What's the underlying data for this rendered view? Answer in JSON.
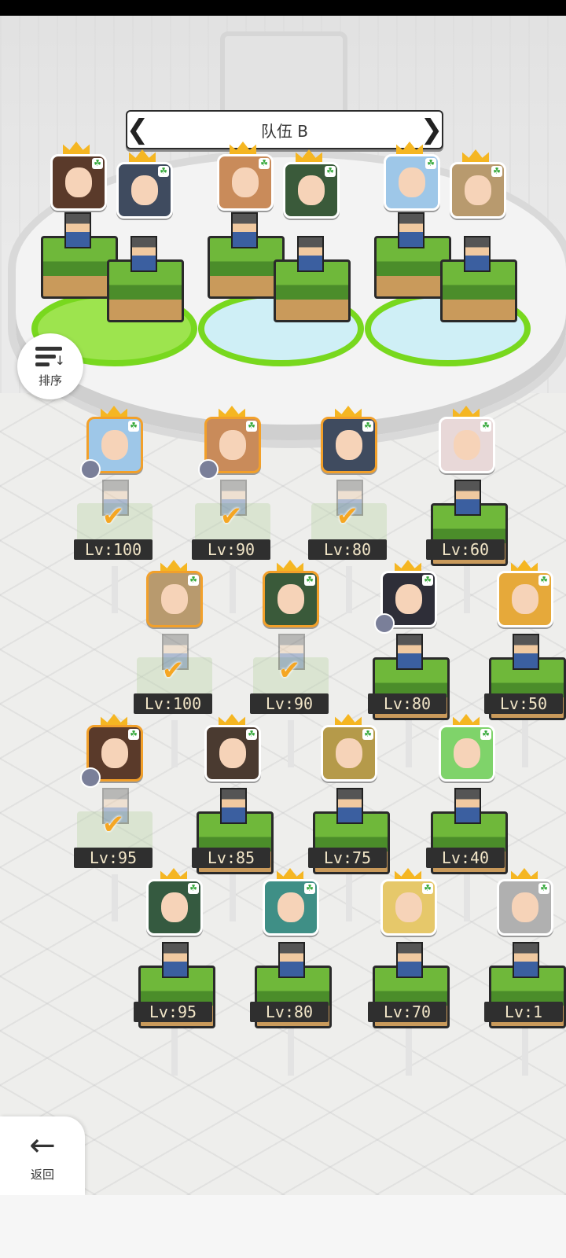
{
  "header": {
    "team_title": "队伍 B",
    "prev_icon": "chevron-left-icon",
    "next_icon": "chevron-right-icon"
  },
  "sort_button": {
    "label": "排序",
    "icon": "sort-icon"
  },
  "back_button": {
    "label": "返回",
    "icon": "arrow-left-icon"
  },
  "team_slots": [
    {
      "portrait_colors": [
        "#5a3a2a",
        "#3f4b5f"
      ]
    },
    {
      "portrait_colors": [
        "#c98b5a",
        "#3a5a3a"
      ]
    },
    {
      "portrait_colors": [
        "#9ec7e8",
        "#b89a6e"
      ]
    }
  ],
  "roster": [
    {
      "level": "Lv:100",
      "selected": true,
      "color": "#9ec7e8"
    },
    {
      "level": "Lv:90",
      "selected": true,
      "color": "#c98b5a"
    },
    {
      "level": "Lv:80",
      "selected": true,
      "color": "#3f4b5f"
    },
    {
      "level": "Lv:60",
      "selected": false,
      "color": "#e8d8d8"
    },
    {
      "level": "Lv:100",
      "selected": true,
      "color": "#b89a6e"
    },
    {
      "level": "Lv:90",
      "selected": true,
      "color": "#3a5a3a"
    },
    {
      "level": "Lv:80",
      "selected": false,
      "color": "#2e2e38"
    },
    {
      "level": "Lv:50",
      "selected": false,
      "color": "#e6a93a"
    },
    {
      "level": "Lv:95",
      "selected": true,
      "color": "#5a3a2a"
    },
    {
      "level": "Lv:85",
      "selected": false,
      "color": "#4a3a30"
    },
    {
      "level": "Lv:75",
      "selected": false,
      "color": "#b59a4a"
    },
    {
      "level": "Lv:40",
      "selected": false,
      "color": "#7fd36a"
    },
    {
      "level": "Lv:95",
      "selected": false,
      "color": "#355a40"
    },
    {
      "level": "Lv:80",
      "selected": false,
      "color": "#3f8f86"
    },
    {
      "level": "Lv:70",
      "selected": false,
      "color": "#e6c86a"
    },
    {
      "level": "Lv:1",
      "selected": false,
      "color": "#b0b0b0"
    }
  ]
}
